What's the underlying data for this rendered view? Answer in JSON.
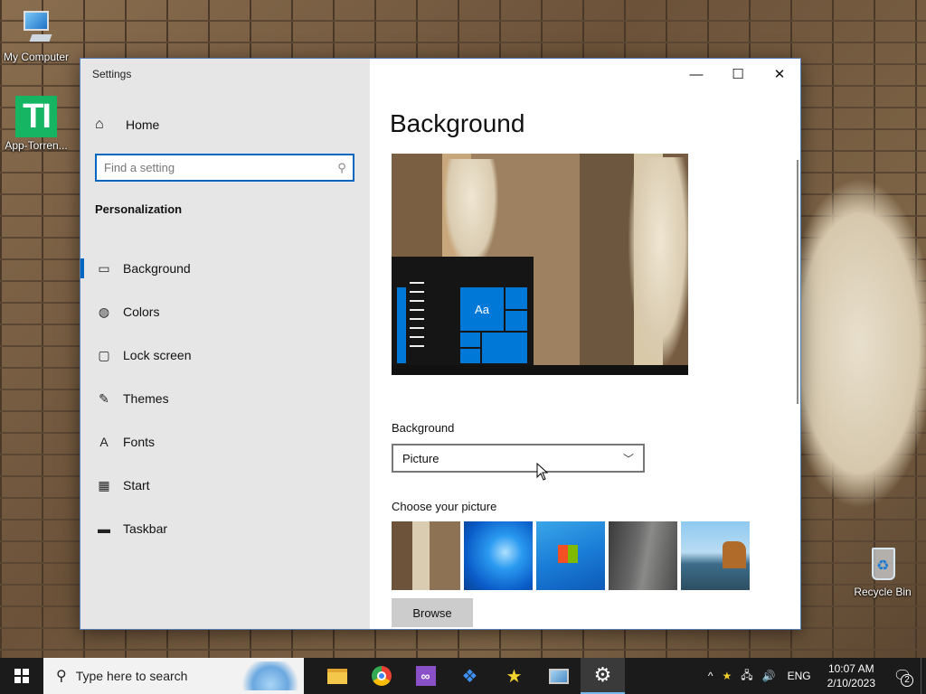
{
  "desktop": {
    "icons": [
      {
        "label": "My Computer"
      },
      {
        "label": "App-Torren..."
      },
      {
        "label": "Recycle Bin"
      }
    ],
    "apptorrent_glyph": "TI"
  },
  "window": {
    "title": "Settings",
    "controls": {
      "minimize": "—",
      "maximize": "☐",
      "close": "✕"
    }
  },
  "sidebar": {
    "home_label": "Home",
    "search_placeholder": "Find a setting",
    "section_header": "Personalization",
    "items": [
      {
        "label": "Background",
        "icon": "picture-icon",
        "active": true
      },
      {
        "label": "Colors",
        "icon": "palette-icon"
      },
      {
        "label": "Lock screen",
        "icon": "lock-screen-icon"
      },
      {
        "label": "Themes",
        "icon": "brush-icon"
      },
      {
        "label": "Fonts",
        "icon": "font-icon"
      },
      {
        "label": "Start",
        "icon": "start-menu-icon"
      },
      {
        "label": "Taskbar",
        "icon": "taskbar-icon"
      }
    ]
  },
  "main": {
    "title": "Background",
    "preview_tile_text": "Aa",
    "background_label": "Background",
    "background_value": "Picture",
    "choose_picture_label": "Choose your picture",
    "browse_label": "Browse"
  },
  "taskbar": {
    "search_placeholder": "Type here to search",
    "apps": [
      {
        "name": "file-explorer"
      },
      {
        "name": "chrome"
      },
      {
        "name": "visual-studio"
      },
      {
        "name": "dropbox"
      },
      {
        "name": "star-app"
      },
      {
        "name": "monitor-app"
      },
      {
        "name": "settings",
        "active": true
      }
    ],
    "tray": {
      "chevron": "^",
      "language": "ENG",
      "time": "10:07 AM",
      "date": "2/10/2023",
      "notification_count": "2"
    }
  },
  "colors": {
    "accent": "#0067c0",
    "sidebar_bg": "#e6e6e6",
    "taskbar_bg": "#1b1b1b",
    "tile_blue": "#0078d7"
  }
}
